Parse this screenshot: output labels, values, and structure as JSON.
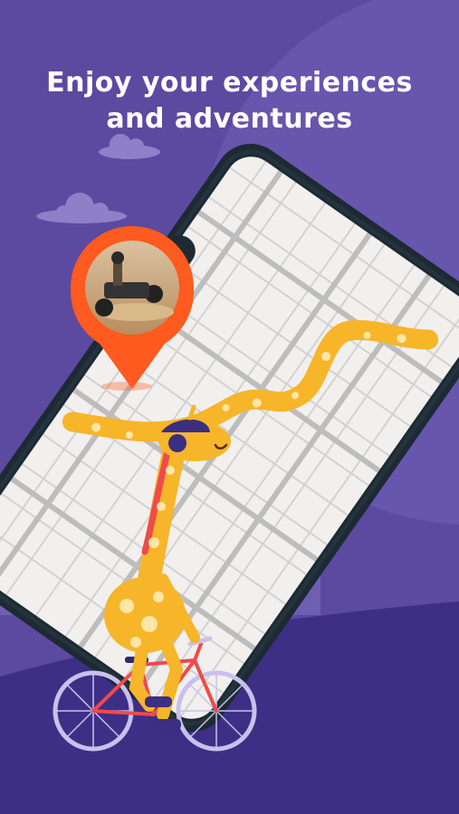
{
  "headline": {
    "line1": "Enjoy your experiences",
    "line2": "and adventures"
  },
  "colors": {
    "background": "#5b4aa0",
    "background_light": "#6656ad",
    "ground": "#3e2f86",
    "skyline": "#6e5fb2",
    "cloud": "#8d80c9",
    "phone_frame": "#1d2a33",
    "map_bg": "#f1f0ee",
    "map_road": "#bdbdbd",
    "route": "#f7b52a",
    "route_spots": "#fde6a6",
    "pin": "#ff5a1f",
    "giraffe": "#f7b52a",
    "bike_frame": "#f04a4a",
    "wheel": "#c8c1ec"
  },
  "icons": {
    "location_pin": "location-pin-icon",
    "cloud": "cloud-icon"
  }
}
